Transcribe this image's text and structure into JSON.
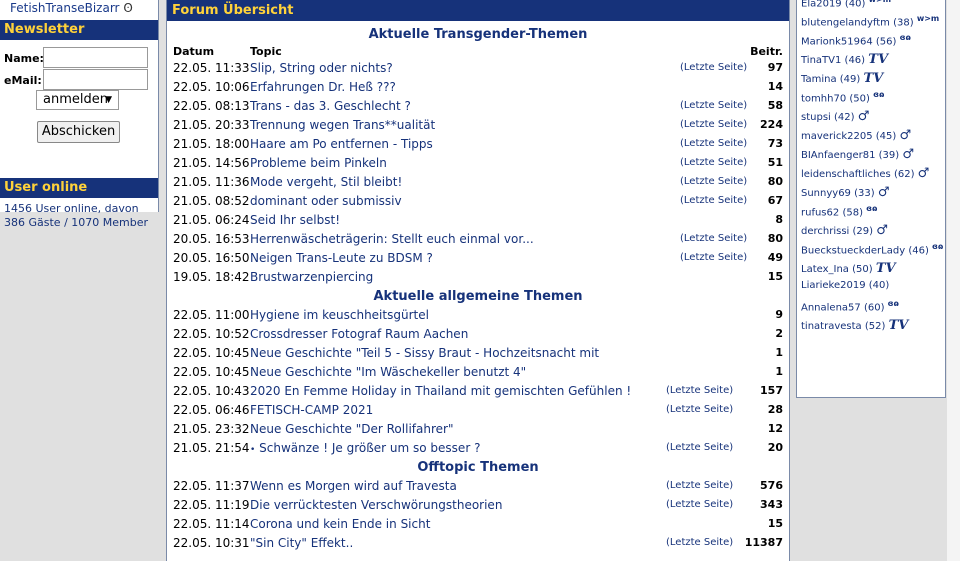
{
  "left": {
    "site_link": "FetishTranseBizarr",
    "newsletter": {
      "title": "Newsletter",
      "name_label": "Name:",
      "email_label": "eMail:",
      "select_value": "anmelden",
      "submit_label": "Abschicken"
    },
    "user_online": {
      "title": "User online",
      "text": "1456 User online, davon 386 Gäste / 1070 Member"
    }
  },
  "center": {
    "title": "Forum Übersicht",
    "col_date": "Datum",
    "col_topic": "Topic",
    "col_count": "Beitr.",
    "sections": [
      {
        "title": "Aktuelle Transgender-Themen",
        "rows": [
          {
            "date": "22.05. 11:33",
            "topic": "Slip, String oder nichts?",
            "last": "(Letzte Seite)",
            "count": "97"
          },
          {
            "date": "22.05. 10:06",
            "topic": "Erfahrungen Dr. Heß ???",
            "last": "",
            "count": "14"
          },
          {
            "date": "22.05. 08:13",
            "topic": "Trans - das 3. Geschlecht ?",
            "last": "(Letzte Seite)",
            "count": "58"
          },
          {
            "date": "21.05. 20:33",
            "topic": "Trennung wegen Trans**ualität",
            "last": "(Letzte Seite)",
            "count": "224"
          },
          {
            "date": "21.05. 18:00",
            "topic": "Haare am Po entfernen - Tipps",
            "last": "(Letzte Seite)",
            "count": "73"
          },
          {
            "date": "21.05. 14:56",
            "topic": "Probleme beim Pinkeln",
            "last": "(Letzte Seite)",
            "count": "51"
          },
          {
            "date": "21.05. 11:36",
            "topic": "Mode vergeht, Stil bleibt!",
            "last": "(Letzte Seite)",
            "count": "80"
          },
          {
            "date": "21.05. 08:52",
            "topic": "dominant oder submissiv",
            "last": "(Letzte Seite)",
            "count": "67"
          },
          {
            "date": "21.05. 06:24",
            "topic": "Seid Ihr selbst!",
            "last": "",
            "count": "8"
          },
          {
            "date": "20.05. 16:53",
            "topic": "Herrenwäscheträgerin: Stellt euch einmal vor...",
            "last": "(Letzte Seite)",
            "count": "80"
          },
          {
            "date": "20.05. 16:50",
            "topic": "Neigen Trans-Leute zu BDSM ?",
            "last": "(Letzte Seite)",
            "count": "49"
          },
          {
            "date": "19.05. 18:42",
            "topic": "Brustwarzenpiercing",
            "last": "",
            "count": "15"
          }
        ]
      },
      {
        "title": "Aktuelle allgemeine Themen",
        "rows": [
          {
            "date": "22.05. 11:00",
            "topic": "Hygiene im keuschheitsgürtel",
            "last": "",
            "count": "9"
          },
          {
            "date": "22.05. 10:52",
            "topic": "Crossdresser Fotograf Raum Aachen",
            "last": "",
            "count": "2"
          },
          {
            "date": "22.05. 10:45",
            "topic": "Neue Geschichte \"Teil 5 - Sissy Braut - Hochzeitsnacht mit",
            "last": "",
            "count": "1"
          },
          {
            "date": "22.05. 10:45",
            "topic": "Neue Geschichte \"Im Wäschekeller benutzt 4\"",
            "last": "",
            "count": "1"
          },
          {
            "date": "22.05. 10:43",
            "topic": "2020 En Femme Holiday in Thailand mit gemischten Gefühlen !",
            "last": "(Letzte Seite)",
            "count": "157"
          },
          {
            "date": "22.05. 06:46",
            "topic": "FETISCH-CAMP 2021",
            "last": "(Letzte Seite)",
            "count": "28"
          },
          {
            "date": "21.05. 23:32",
            "topic": "Neue Geschichte \"Der Rollifahrer\"",
            "last": "",
            "count": "12"
          },
          {
            "date": "21.05. 21:54",
            "topic": "Schwänze ! Je größer um so besser ?",
            "last": "(Letzte Seite)",
            "count": "20",
            "bullet": "•"
          }
        ]
      },
      {
        "title": "Offtopic Themen",
        "rows": [
          {
            "date": "22.05. 11:37",
            "topic": "Wenn es Morgen wird auf Travesta",
            "last": "(Letzte Seite)",
            "count": "576"
          },
          {
            "date": "22.05. 11:19",
            "topic": "Die verrücktesten Verschwörungstheorien",
            "last": "(Letzte Seite)",
            "count": "343"
          },
          {
            "date": "22.05. 11:14",
            "topic": "Corona und kein Ende in Sicht",
            "last": "",
            "count": "15"
          },
          {
            "date": "22.05. 10:31",
            "topic": "\"Sin City\" Effekt..",
            "last": "(Letzte Seite)",
            "count": "11387"
          }
        ]
      }
    ]
  },
  "right": {
    "members": [
      {
        "name": "Ela2019",
        "age": "(40)",
        "icon": "partner-icon"
      },
      {
        "name": "blutengelandyftm",
        "age": "(38)",
        "icon": "partner-icon"
      },
      {
        "name": "Marionk51964",
        "age": "(56)",
        "icon": "couple-icon"
      },
      {
        "name": "TinaTV1",
        "age": "(46)",
        "icon": "tv-icon"
      },
      {
        "name": "Tamina",
        "age": "(49)",
        "icon": "tv-icon"
      },
      {
        "name": "tomhh70",
        "age": "(50)",
        "icon": "couple-icon"
      },
      {
        "name": "stupsi",
        "age": "(42)",
        "icon": "male-icon"
      },
      {
        "name": "maverick2205",
        "age": "(45)",
        "icon": "male-icon"
      },
      {
        "name": "BIAnfaenger81",
        "age": "(39)",
        "icon": "male-icon"
      },
      {
        "name": "leidenschaftliches",
        "age": "(62)",
        "icon": "male-icon"
      },
      {
        "name": "Sunnyy69",
        "age": "(33)",
        "icon": "male-icon"
      },
      {
        "name": "rufus62",
        "age": "(58)",
        "icon": "couple-icon"
      },
      {
        "name": "derchrissi",
        "age": "(29)",
        "icon": "male-icon"
      },
      {
        "name": "BueckstueckderLady",
        "age": "(46)",
        "icon": "couple-icon"
      },
      {
        "name": "Latex_Ina",
        "age": "(50)",
        "icon": "tv-icon"
      },
      {
        "name": "Liarieke2019",
        "age": "(40)",
        "icon": ""
      },
      {
        "name": "Annalena57",
        "age": "(60)",
        "icon": "couple-icon"
      },
      {
        "name": "tinatravesta",
        "age": "(52)",
        "icon": "tv-icon"
      }
    ]
  }
}
